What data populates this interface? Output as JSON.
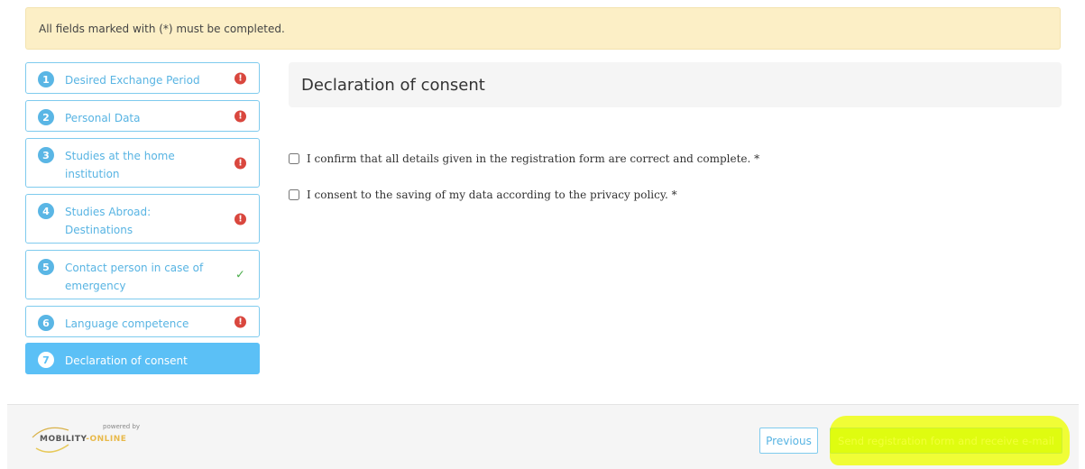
{
  "banner": {
    "text": "All fields marked with (*) must be completed."
  },
  "steps": [
    {
      "number": "1",
      "label": "Desired Exchange Period",
      "status": "incomplete"
    },
    {
      "number": "2",
      "label": "Personal Data",
      "status": "incomplete"
    },
    {
      "number": "3",
      "label": "Studies at the home institution",
      "status": "incomplete"
    },
    {
      "number": "4",
      "label": "Studies Abroad: Destinations",
      "status": "incomplete"
    },
    {
      "number": "5",
      "label": "Contact person in case of emergency",
      "status": "complete"
    },
    {
      "number": "6",
      "label": "Language competence",
      "status": "incomplete"
    },
    {
      "number": "7",
      "label": "Declaration of consent",
      "status": "active"
    }
  ],
  "status_icons": {
    "incomplete": "exclamation-icon",
    "complete": "check-icon"
  },
  "colors": {
    "accent": "#5bc0f6",
    "warning": "#d9473e",
    "success": "#4cae4c",
    "banner": "#fcefc6",
    "highlight": "#eeff00"
  },
  "main": {
    "title": "Declaration of consent",
    "confirm_details": {
      "label": "I confirm that all details given in the registration form are correct and complete. *",
      "checked": false
    },
    "consent_privacy": {
      "label": "I consent to the saving of my data according to the privacy policy. *",
      "checked": false
    }
  },
  "footer": {
    "powered_by": "powered by",
    "brand_part1": "MOBILITY",
    "brand_part2": "-ONLINE",
    "previous_label": "Previous",
    "send_label": "Send registration form and receive e-mail"
  }
}
